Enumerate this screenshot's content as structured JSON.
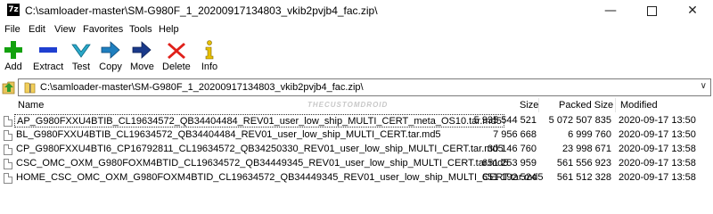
{
  "window": {
    "title": "C:\\samloader-master\\SM-G980F_1_20200917134803_vkib2pvjb4_fac.zip\\",
    "app_icon": "7z"
  },
  "menu": [
    "File",
    "Edit",
    "View",
    "Favorites",
    "Tools",
    "Help"
  ],
  "toolbar": [
    {
      "label": "Add",
      "icon": "plus-icon",
      "color": "#13a10e"
    },
    {
      "label": "Extract",
      "icon": "minus-icon",
      "color": "#1f3fd0"
    },
    {
      "label": "Test",
      "icon": "check-icon",
      "color": "#2aa8c8"
    },
    {
      "label": "Copy",
      "icon": "copy-arrow-icon",
      "color": "#1f7fbf"
    },
    {
      "label": "Move",
      "icon": "move-arrow-icon",
      "color": "#1a3a8a"
    },
    {
      "label": "Delete",
      "icon": "delete-x-icon",
      "color": "#e0201a"
    },
    {
      "label": "Info",
      "icon": "info-icon",
      "color": "#e8c000"
    }
  ],
  "address": {
    "path": "C:\\samloader-master\\SM-G980F_1_20200917134803_vkib2pvjb4_fac.zip\\"
  },
  "columns": {
    "name": "Name",
    "size": "Size",
    "packed": "Packed Size",
    "modified": "Modified"
  },
  "watermark": "THECUSTOMDROID",
  "files": [
    {
      "name": "AP_G980FXXU4BTIB_CL19634572_QB34404484_REV01_user_low_ship_MULTI_CERT_meta_OS10.tar.md5",
      "size": "5 935 544 521",
      "packed": "5 072 507 835",
      "modified": "2020-09-17 13:50",
      "selected": true
    },
    {
      "name": "BL_G980FXXU4BTIB_CL19634572_QB34404484_REV01_user_low_ship_MULTI_CERT.tar.md5",
      "size": "7 956 668",
      "packed": "6 999 760",
      "modified": "2020-09-17 13:50",
      "selected": false
    },
    {
      "name": "CP_G980FXXU4BTI6_CP16792811_CL19634572_QB34250330_REV01_user_low_ship_MULTI_CERT.tar.md5",
      "size": "30 146 760",
      "packed": "23 998 671",
      "modified": "2020-09-17 13:58",
      "selected": false
    },
    {
      "name": "CSC_OMC_OXM_G980FOXM4BTID_CL19634572_QB34449345_REV01_user_low_ship_MULTI_CERT.tar.md5",
      "size": "651 253 959",
      "packed": "561 556 923",
      "modified": "2020-09-17 13:58",
      "selected": false
    },
    {
      "name": "HOME_CSC_OMC_OXM_G980FOXM4BTID_CL19634572_QB34449345_REV01_user_low_ship_MULTI_CERT.tar.md5",
      "size": "651 192 524",
      "packed": "561 512 328",
      "modified": "2020-09-17 13:58",
      "selected": false
    }
  ]
}
